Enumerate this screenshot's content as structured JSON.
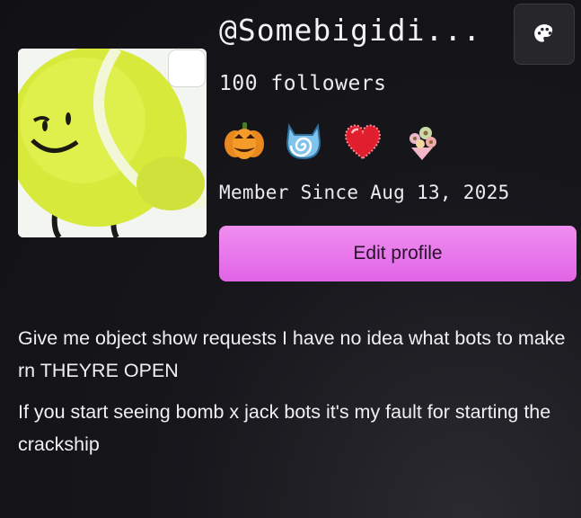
{
  "profile": {
    "username": "@Somebigidi...",
    "followers": "100 followers",
    "member_since": "Member Since Aug 13, 2025",
    "edit_label": "Edit profile",
    "badges": [
      {
        "icon": "pumpkin-badge-icon"
      },
      {
        "icon": "swirl-cat-badge-icon"
      },
      {
        "icon": "heart-badge-icon"
      },
      {
        "icon": "flower-bouquet-badge-icon"
      }
    ]
  },
  "bio": {
    "paragraphs": [
      "Give me object show requests I have no idea what bots to make rn THEYRE OPEN",
      "If you start seeing bomb x jack bots it's my fault for starting the crackship"
    ]
  },
  "colors": {
    "accent": "#e87ae9",
    "background": "#16161b"
  }
}
